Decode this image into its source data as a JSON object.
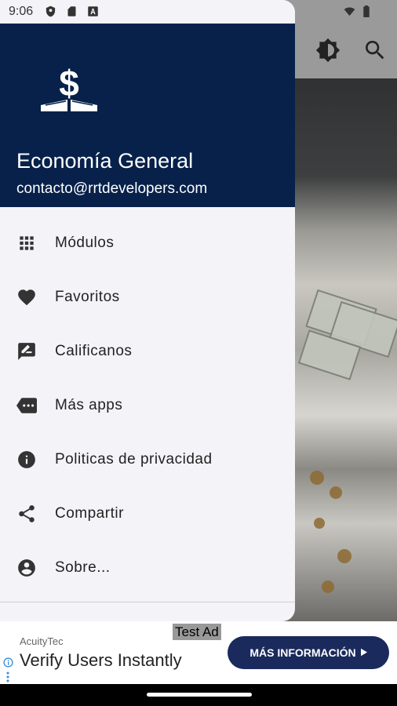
{
  "status_bar": {
    "time": "9:06"
  },
  "background_app": {
    "appbar_icons": [
      "brightness-icon",
      "search-icon"
    ]
  },
  "drawer": {
    "title": "Economía General",
    "email": "contacto@rrtdevelopers.com",
    "logo_icon": "dollar-book-icon",
    "items": [
      {
        "label": "Módulos",
        "icon": "grid-icon"
      },
      {
        "label": "Favoritos",
        "icon": "heart-icon"
      },
      {
        "label": "Calificanos",
        "icon": "rate-review-icon"
      },
      {
        "label": "Más apps",
        "icon": "more-apps-icon"
      },
      {
        "label": "Politicas de privacidad",
        "icon": "info-icon"
      },
      {
        "label": "Compartir",
        "icon": "share-icon"
      },
      {
        "label": "Sobre...",
        "icon": "account-circle-icon"
      }
    ]
  },
  "ad": {
    "test_label": "Test Ad",
    "advertiser": "AcuityTec",
    "headline": "Verify Users Instantly",
    "cta": "MÁS INFORMACIÓN"
  },
  "colors": {
    "header": "#07214a",
    "drawer_bg": "#f4f3f8",
    "cta_bg": "#1b2a5c"
  }
}
